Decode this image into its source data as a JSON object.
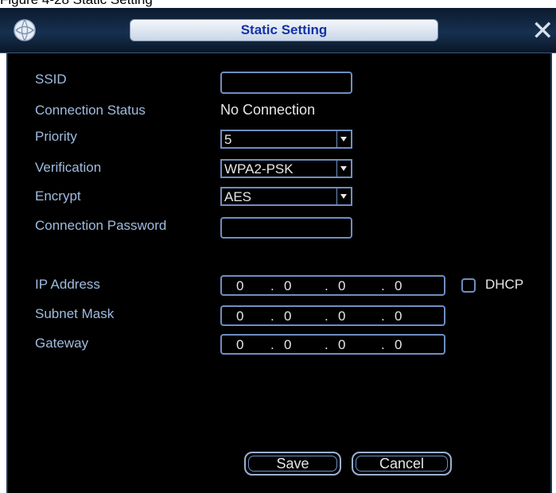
{
  "page_caption": "Figure 4-28 Static Setting",
  "dialog": {
    "title": "Static Setting",
    "icons": {
      "app": "globe-app-icon",
      "close": "close-icon"
    },
    "close_glyph": "✕"
  },
  "form": {
    "ssid": {
      "label": "SSID",
      "value": ""
    },
    "connection_status": {
      "label": "Connection Status",
      "value": "No Connection"
    },
    "priority": {
      "label": "Priority",
      "value": "5"
    },
    "verification": {
      "label": "Verification",
      "value": "WPA2-PSK"
    },
    "encrypt": {
      "label": "Encrypt",
      "value": "AES"
    },
    "connection_password": {
      "label": "Connection Password",
      "value": ""
    }
  },
  "network": {
    "ip_address": {
      "label": "IP Address",
      "octets": [
        "0",
        "0",
        "0",
        "0"
      ]
    },
    "subnet_mask": {
      "label": "Subnet Mask",
      "octets": [
        "0",
        "0",
        "0",
        "0"
      ]
    },
    "gateway": {
      "label": "Gateway",
      "octets": [
        "0",
        "0",
        "0",
        "0"
      ]
    },
    "dhcp": {
      "label": "DHCP",
      "checked": false
    }
  },
  "buttons": {
    "save": "Save",
    "cancel": "Cancel"
  },
  "colors": {
    "label": "#9fbcdf",
    "value": "#e6e6e6",
    "border": "#6f8ec2",
    "title": "#1432a8",
    "background": "#000000"
  }
}
